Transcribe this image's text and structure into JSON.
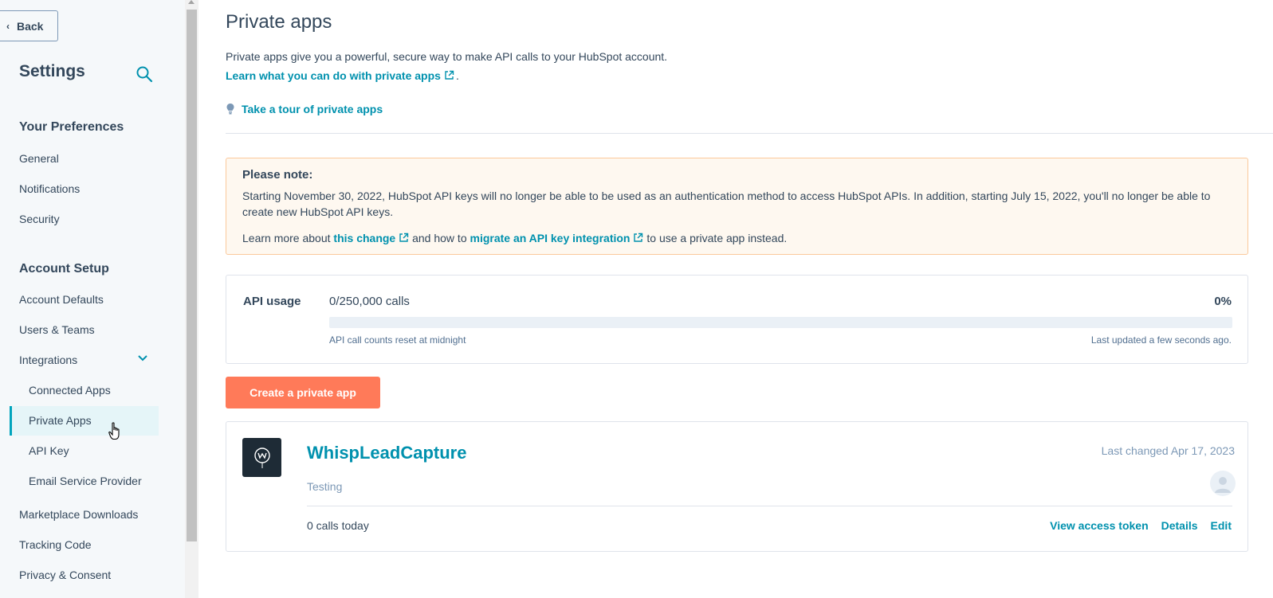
{
  "sidebar": {
    "back_label": "Back",
    "title": "Settings",
    "sections": [
      {
        "heading": "Your Preferences",
        "items": [
          "General",
          "Notifications",
          "Security"
        ]
      },
      {
        "heading": "Account Setup",
        "items": [
          "Account Defaults",
          "Users & Teams",
          "Integrations"
        ]
      }
    ],
    "integrations_subitems": [
      "Connected Apps",
      "Private Apps",
      "API Key",
      "Email Service Provider"
    ],
    "more_items": [
      "Marketplace Downloads",
      "Tracking Code",
      "Privacy & Consent"
    ],
    "active_item": "Private Apps"
  },
  "main": {
    "title": "Private apps",
    "description": "Private apps give you a powerful, secure way to make API calls to your HubSpot account.",
    "learn_link": "Learn what you can do with private apps",
    "learn_suffix": ".",
    "tour_link": "Take a tour of private apps"
  },
  "note": {
    "heading": "Please note:",
    "body": "Starting November 30, 2022, HubSpot API keys will no longer be able to be used as an authentication method to access HubSpot APIs. In addition, starting July 15, 2022, you'll no longer be able to create new HubSpot API keys.",
    "learn_prefix": "Learn more about",
    "change_link": "this change",
    "middle": "and how to",
    "migrate_link": "migrate an API key integration",
    "suffix": "to use a private app instead."
  },
  "usage": {
    "label": "API usage",
    "calls": "0/250,000 calls",
    "percent": "0%",
    "progress": 0,
    "reset_note": "API call counts reset at midnight",
    "updated_note": "Last updated a few seconds ago."
  },
  "create_button": "Create a private app",
  "app": {
    "name": "WhispLeadCapture",
    "description": "Testing",
    "last_changed": "Last changed Apr 17, 2023",
    "calls_today": "0 calls today",
    "actions": [
      "View access token",
      "Details",
      "Edit"
    ]
  },
  "colors": {
    "accent": "#0091ae",
    "primary_button": "#ff7a59",
    "note_bg": "#fef8f0",
    "note_border": "#fbc99b"
  }
}
